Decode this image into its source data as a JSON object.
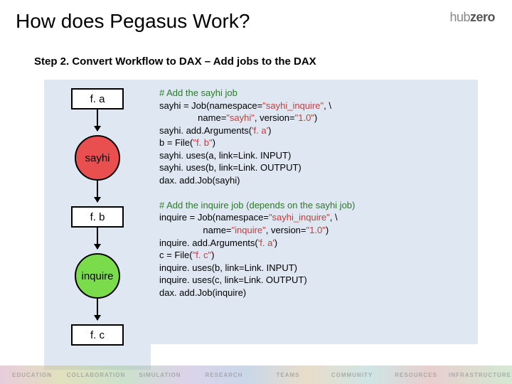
{
  "title": "How does Pegasus Work?",
  "logo": {
    "prefix": "hub",
    "suffix": "zero"
  },
  "step": "Step 2. Convert Workflow to DAX – Add jobs to the DAX",
  "diagram": {
    "fa": "f. a",
    "sayhi": "sayhi",
    "fb": "f. b",
    "inquire": "inquire",
    "fc": "f. c"
  },
  "code": {
    "c1": "# Add the sayhi job",
    "l1a": "sayhi = Job(namespace=",
    "s1": "\"sayhi_inquire\"",
    "l1b": ", \\",
    "l2a": "               name=",
    "s2": "\"sayhi\"",
    "l2b": ", version=",
    "s3": "\"1.0\"",
    "l2c": ")",
    "l3a": "sayhi. add.Arguments(",
    "s4": "'f. a'",
    "l3b": ")",
    "l4a": "b = File(",
    "s5": "\"f. b\"",
    "l4b": ")",
    "l5": "sayhi. uses(a, link=Link. INPUT)",
    "l6": "sayhi. uses(b, link=Link. OUTPUT)",
    "l7": "dax. add.Job(sayhi)",
    "c2": "# Add the inquire job (depends on the sayhi job)",
    "l8a": "inquire = Job(namespace=",
    "s6": "\"sayhi_inquire\"",
    "l8b": ", \\",
    "l9a": "                 name=",
    "s7": "\"inquire\"",
    "l9b": ", version=",
    "s8": "\"1.0\"",
    "l9c": ")",
    "l10a": "inquire. add.Arguments(",
    "s9": "'f. a'",
    "l10b": ")",
    "l11a": "c = File(",
    "s10": "\"f. c\"",
    "l11b": ")",
    "l12": "inquire. uses(b, link=Link. INPUT)",
    "l13": "inquire. uses(c, link=Link. OUTPUT)",
    "l14": "dax. add.Job(inquire)"
  },
  "footer": [
    "EDUCATION",
    "COLLABORATION",
    "SIMULATION",
    "RESEARCH",
    "TEAMS",
    "COMMUNITY",
    "RESOURCES",
    "INFRASTRUCTURE"
  ]
}
